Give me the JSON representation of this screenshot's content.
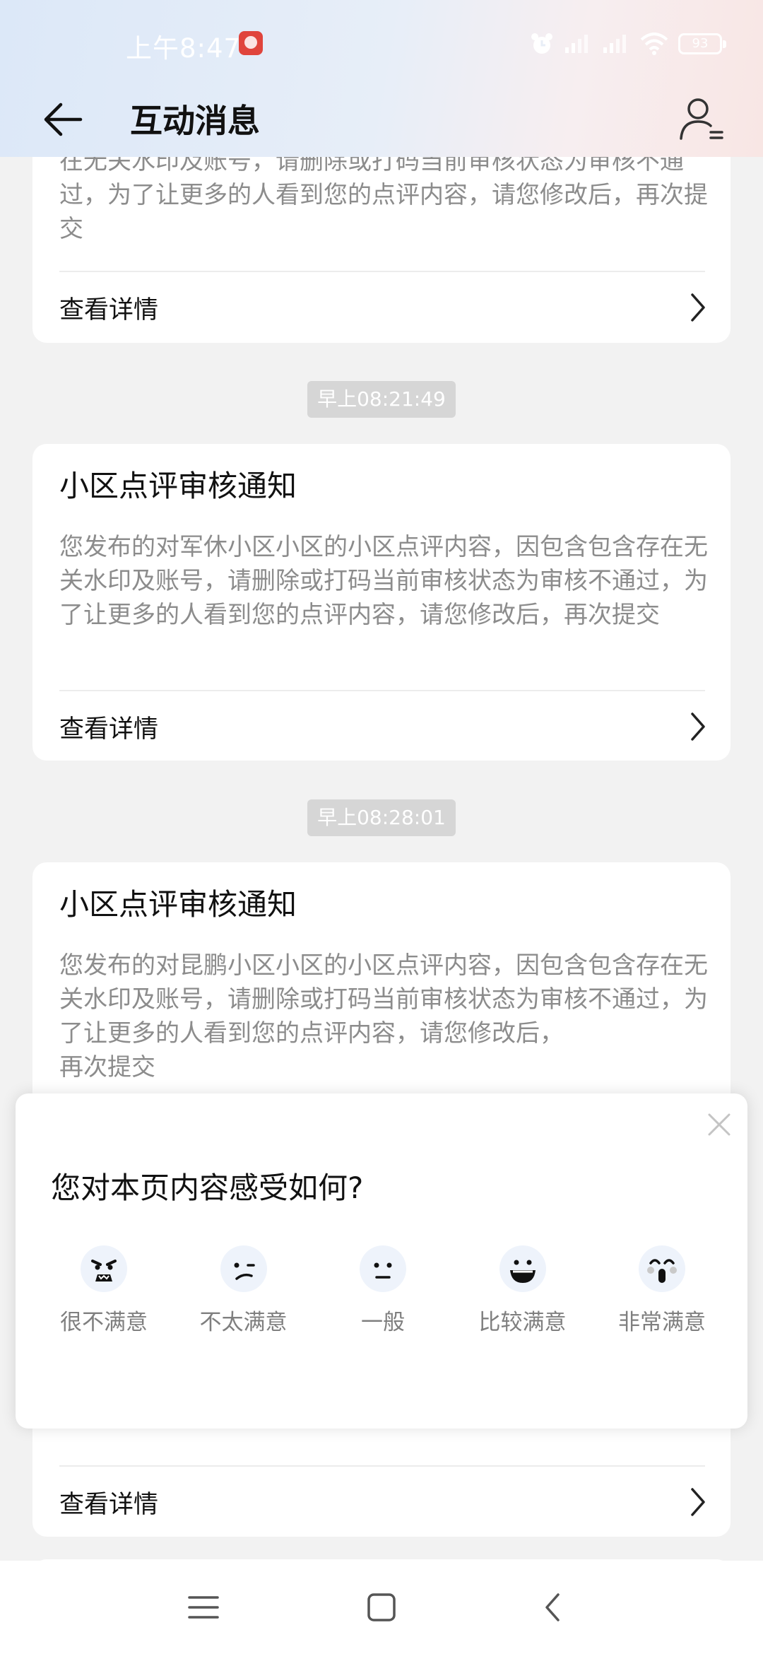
{
  "status_bar": {
    "time": "上午8:47",
    "battery": "93"
  },
  "header": {
    "title": "互动消息"
  },
  "messages": [
    {
      "title": "",
      "body": "在无关水印及账号，请删除或打码当前审核状态为审核不通过，为了让更多的人看到您的点评内容，请您修改后，再次提交",
      "action": "查看详情"
    },
    {
      "timestamp": "早上08:21:49",
      "title": "小区点评审核通知",
      "body": "您发布的对军休小区小区的小区点评内容，因包含包含存在无关水印及账号，请删除或打码当前审核状态为审核不通过，为了让更多的人看到您的点评内容，请您修改后，再次提交",
      "action": "查看详情"
    },
    {
      "timestamp": "早上08:28:01",
      "title": "小区点评审核通知",
      "body": "您发布的对昆鹏小区小区的小区点评内容，因包含包含存在无关水印及账号，请删除或打码当前审核状态为审核不通过，为了让更多的人看到您的点评内容，请您修改后，",
      "body_tail": "再次提交",
      "action": "查看详情"
    }
  ],
  "feedback": {
    "question": "您对本页内容感受如何?",
    "options": [
      {
        "label": "很不满意",
        "icon": "angry-face-icon"
      },
      {
        "label": "不太满意",
        "icon": "unhappy-face-icon"
      },
      {
        "label": "一般",
        "icon": "neutral-face-icon"
      },
      {
        "label": "比较满意",
        "icon": "smile-face-icon"
      },
      {
        "label": "非常满意",
        "icon": "excited-face-icon"
      }
    ]
  },
  "colors": {
    "card_bg": "#ffffff",
    "page_bg": "#f2f2f2",
    "muted_text": "#8c8c8c",
    "timestamp_bg": "#d6d6d6"
  }
}
